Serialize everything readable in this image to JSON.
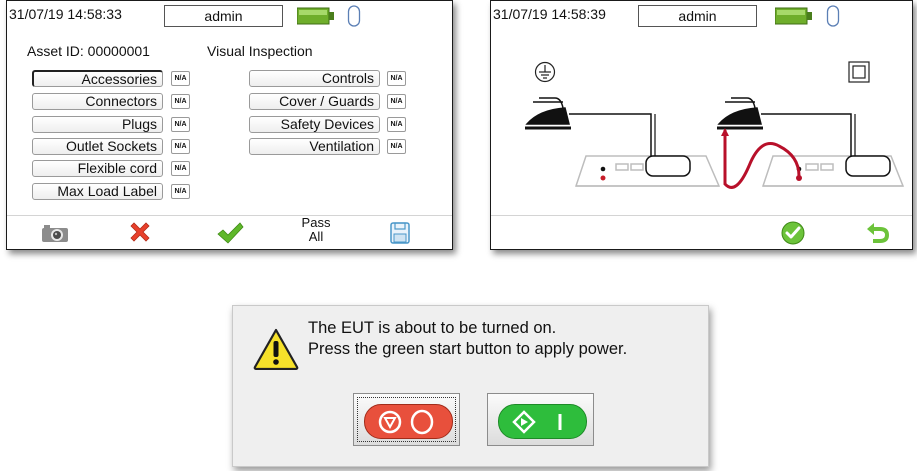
{
  "screen1": {
    "datetime": "31/07/19 14:58:33",
    "user": "admin",
    "asset_id": "Asset ID: 00000001",
    "section_title": "Visual Inspection",
    "left_items": [
      {
        "label": "Accessories",
        "status": "N/A"
      },
      {
        "label": "Connectors",
        "status": "N/A"
      },
      {
        "label": "Plugs",
        "status": "N/A"
      },
      {
        "label": "Outlet Sockets",
        "status": "N/A"
      },
      {
        "label": "Flexible cord",
        "status": "N/A"
      },
      {
        "label": "Max Load Label",
        "status": "N/A"
      }
    ],
    "right_items": [
      {
        "label": "Controls",
        "status": "N/A"
      },
      {
        "label": "Cover / Guards",
        "status": "N/A"
      },
      {
        "label": "Safety Devices",
        "status": "N/A"
      },
      {
        "label": "Ventilation",
        "status": "N/A"
      }
    ],
    "toolbar": {
      "camera_icon": "camera-icon",
      "fail_icon": "red-x-icon",
      "pass_icon": "green-check-icon",
      "pass_all_line1": "Pass",
      "pass_all_line2": "All",
      "save_icon": "save-icon"
    }
  },
  "screen2": {
    "datetime": "31/07/19 14:58:39",
    "user": "admin",
    "class1_symbol": "earth-symbol",
    "class2_symbol": "double-insulation-symbol",
    "toolbar": {
      "ok_icon": "green-check-circle-icon",
      "back_icon": "green-return-arrow-icon"
    }
  },
  "dialog": {
    "line1": "The EUT is about to be turned on.",
    "line2": "Press the green start button to apply power.",
    "warning_icon": "warning-icon",
    "stop_icon": "red-stop-button-icon",
    "start_icon": "green-start-button-icon"
  },
  "colors": {
    "battery_green": "#6fae2b",
    "fail_red": "#e8402b",
    "pass_green": "#5fb82a",
    "stop_red": "#e8503c",
    "start_green": "#2ebd3c",
    "lead_red": "#b8102a",
    "save_blue": "#4a97c9"
  }
}
